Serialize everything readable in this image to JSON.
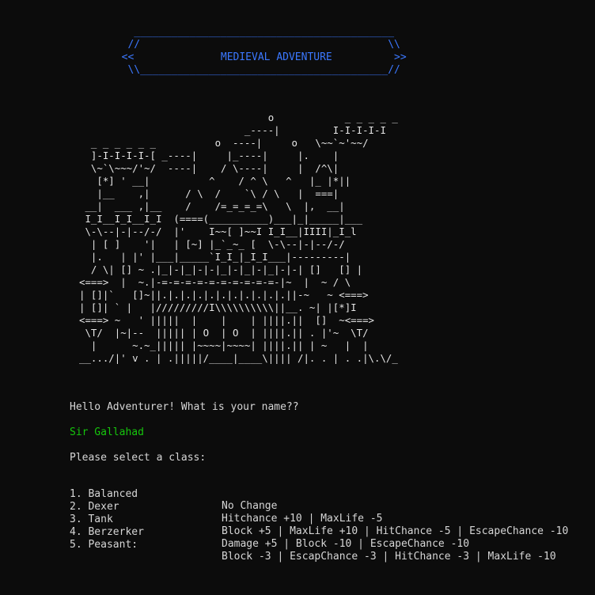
{
  "banner": {
    "title": "MEDIEVAL ADVENTURE",
    "art": "    __________________________________________\n   //                                        \\\\\n  <<              MEDIEVAL ADVENTURE          >>\n   \\\\________________________________________//"
  },
  "castle_art": "                                o            _ _ _ _ _\n                            _----|         I-I-I-I-I\n  _ _ _ _ _ _          o  ----|     o   \\~~`~'~~/\n  ]-I-I-I-I-[ _----|     |_----|     |.    |\n  \\~`\\~~~/'~/  ----|    / \\----|     |  /^\\|\n   [*] ' __|          ^    / ^ \\   ^   |_ |*||\n   |__    ,|      / \\  /    `\\ / \\   |  ===|\n __|  ___ ,|__    /    /=_=_=_=\\   \\  |,  __|\n I_I__I_I__I_I  (====(__________)___|_|_____|___\n \\-\\--|-|--/-/  |'    I~~[ ]~~I I_I__|IIII|_I_l\n  | [ ]    '|   | [~] |_`_~_ [  \\-\\--|-|--/-/\n  |.   | |' |___|_____`I_I_|_I_I___|---------|\n  / \\| [] ~ .|_|-|_|-|-|_|-|_|-|_|-|-| []   [] |\n<===>  |  ~.|-=-=-=-=-=-=-=-=-=-=-|~  |  ~ / \\\n| []|`   []~||.|.|.|.|.|.|.|.|.|.|.||-~   ~ <===>\n| []| ` |   |/////////I\\\\\\\\\\\\\\\\\\\\||__. ~| |[*]I\n<===> ~   ' |||||  |    |    | ||||.||  []  ~<===>\n \\T/  |~|--  ||||| | O  | O  | ||||.|| . |'~  \\T/\n  |      ~.~_||||| |~~~~|~~~~| ||||.|| | ~   |  |\n__.../|' v . | .|||||/____|____\\|||| /|. . | . .|\\.\\/_",
  "prompt": {
    "greeting": "Hello Adventurer! What is your name??",
    "player_name": "Sir Gallahad",
    "class_prompt": "Please select a class:"
  },
  "classes": [
    {
      "label": "1. Balanced",
      "effect": "No Change"
    },
    {
      "label": "2. Dexer",
      "effect": "Hitchance +10 | MaxLife -5"
    },
    {
      "label": "3. Tank",
      "effect": "Block +5 | MaxLife +10 | HitChance -5 | EscapeChance -10"
    },
    {
      "label": "4. Berzerker",
      "effect": "Damage +5 | Block -10 | EscapeChance -10"
    },
    {
      "label": "5. Peasant:",
      "effect": "Block -3 | EscapChance -3 | HitChance -3 | MaxLife -10"
    }
  ],
  "colors": {
    "background": "#0c0c0c",
    "text": "#d6d6d6",
    "banner": "#3b78ff",
    "input": "#16c60c"
  }
}
